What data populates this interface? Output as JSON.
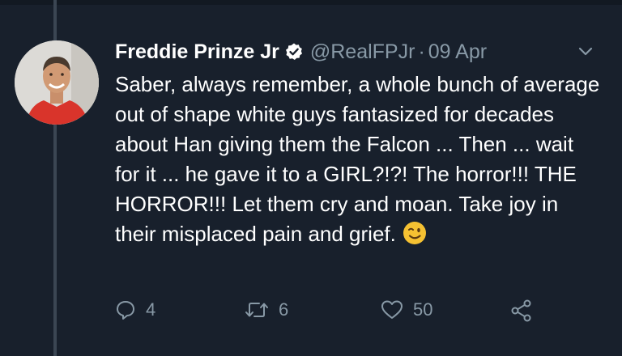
{
  "tweet": {
    "author_name": "Freddie Prinze Jr",
    "handle": "@RealFPJr",
    "separator": "·",
    "date": "09 Apr",
    "text": "Saber, always remember, a whole bunch of average out of shape white guys fantasized for decades about Han giving them the Falcon ... Then ... wait for it ... he gave it to a GIRL?!?! The horror!!! THE HORROR!!! Let them cry and moan. Take joy in their misplaced pain and grief.",
    "emoji": "winking-face",
    "verified": true
  },
  "actions": {
    "replies": "4",
    "retweets": "6",
    "likes": "50"
  },
  "colors": {
    "background": "#18202c",
    "secondary_text": "#8899a6",
    "thread_line": "#3b4653"
  },
  "icons": [
    "verified-badge-icon",
    "chevron-down-icon",
    "reply-icon",
    "retweet-icon",
    "like-icon",
    "share-icon"
  ]
}
